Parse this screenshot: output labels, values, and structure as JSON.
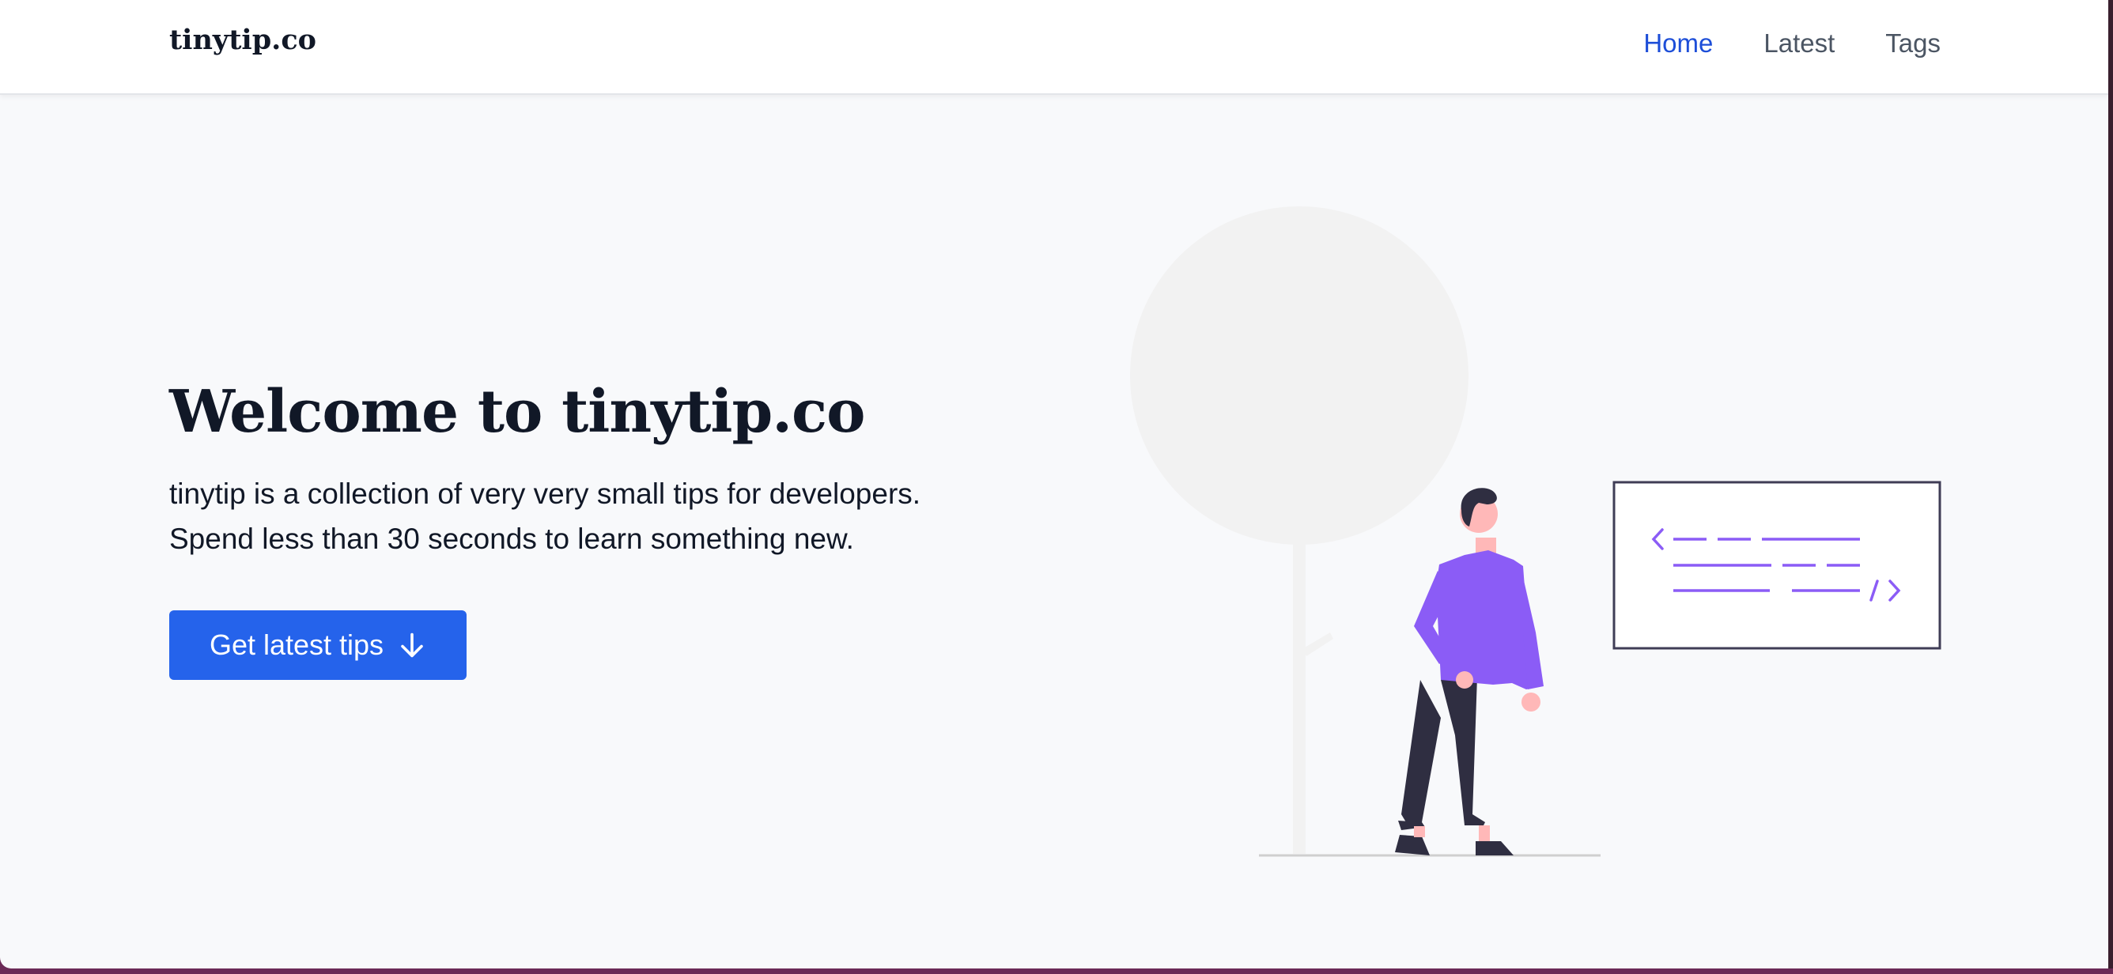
{
  "navbar": {
    "brand": "tinytip.co",
    "links": [
      {
        "label": "Home",
        "active": true
      },
      {
        "label": "Latest",
        "active": false
      },
      {
        "label": "Tags",
        "active": false
      }
    ]
  },
  "hero": {
    "title": "Welcome to tinytip.co",
    "line1": "tinytip is a collection of very very small tips for developers.",
    "line2": "Spend less than 30 seconds to learn something new.",
    "cta_label": "Get latest tips",
    "cta_icon": "arrow-down-icon"
  },
  "illustration": {
    "accent_color": "#8b5cf6",
    "icon": "code-window-illustration"
  },
  "colors": {
    "primary": "#2563eb",
    "nav_active": "#1d4ed8",
    "text": "#111827",
    "background": "#f8f9fb"
  }
}
